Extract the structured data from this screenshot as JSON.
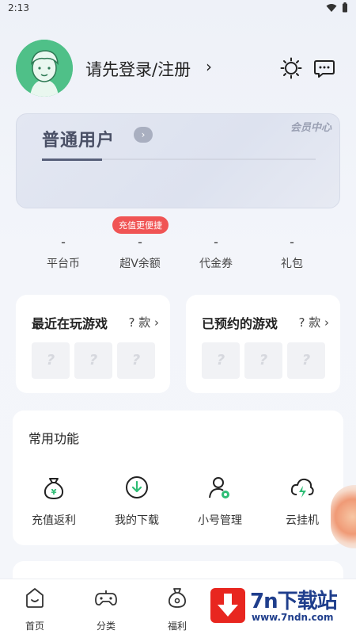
{
  "status": {
    "time": "2:13"
  },
  "profile": {
    "login_text": "请先登录/注册",
    "chevron": "›",
    "theme_icon": "sun-icon",
    "message_icon": "message-icon"
  },
  "member": {
    "title": "普通用户",
    "arrow": "›",
    "center_label": "会员中心",
    "progress": 0.22
  },
  "badge": {
    "text": "充值更便捷"
  },
  "stats": [
    {
      "value": "-",
      "label": "平台币"
    },
    {
      "value": "-",
      "label": "超V余额"
    },
    {
      "value": "-",
      "label": "代金券"
    },
    {
      "value": "-",
      "label": "礼包"
    }
  ],
  "recent_games": {
    "title": "最近在玩游戏",
    "count": "? 款 ›",
    "slots": [
      "?",
      "?",
      "?"
    ]
  },
  "reserved_games": {
    "title": "已预约的游戏",
    "count": "? 款 ›",
    "slots": [
      "?",
      "?",
      "?"
    ]
  },
  "functions": {
    "title": "常用功能",
    "items": [
      {
        "label": "充值返利",
        "icon": "money-bag-icon"
      },
      {
        "label": "我的下载",
        "icon": "download-icon"
      },
      {
        "label": "小号管理",
        "icon": "account-manage-icon"
      },
      {
        "label": "云挂机",
        "icon": "cloud-bolt-icon"
      }
    ]
  },
  "nav": [
    {
      "label": "首页",
      "icon": "home-icon"
    },
    {
      "label": "分类",
      "icon": "gamepad-icon"
    },
    {
      "label": "福利",
      "icon": "gift-bag-icon"
    }
  ],
  "watermark": {
    "big": "7n下载站",
    "small": "www.7ndn.com"
  },
  "colors": {
    "accent_red": "#f05454",
    "avatar_green": "#4fc088",
    "watermark_blue": "#1f3e8c"
  }
}
